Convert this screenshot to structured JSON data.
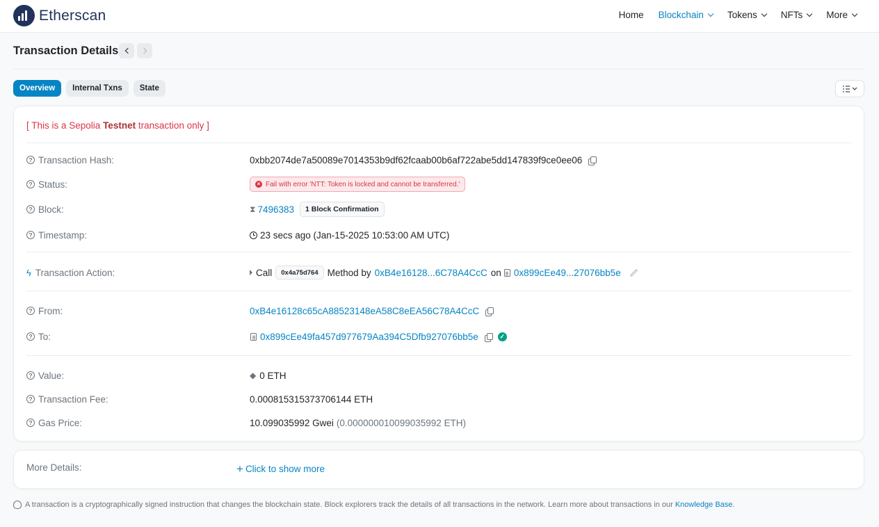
{
  "brand": {
    "name": "Etherscan"
  },
  "nav": [
    {
      "label": "Home",
      "has_dropdown": false,
      "active": false
    },
    {
      "label": "Blockchain",
      "has_dropdown": true,
      "active": true
    },
    {
      "label": "Tokens",
      "has_dropdown": true,
      "active": false
    },
    {
      "label": "NFTs",
      "has_dropdown": true,
      "active": false
    },
    {
      "label": "More",
      "has_dropdown": true,
      "active": false
    }
  ],
  "page": {
    "title": "Transaction Details"
  },
  "tabs": [
    {
      "label": "Overview",
      "active": true
    },
    {
      "label": "Internal Txns",
      "active": false
    },
    {
      "label": "State",
      "active": false
    }
  ],
  "notice": {
    "prefix": "[ This is a Sepolia ",
    "strong": "Testnet",
    "suffix": " transaction only ]"
  },
  "details": {
    "hash": {
      "label": "Transaction Hash:",
      "value": "0xbb2074de7a50089e7014353b9df62fcaab00b6af722abe5dd147839f9ce0ee06"
    },
    "status": {
      "label": "Status:",
      "value": "Fail with error 'NTT: Token is locked and cannot be transferred.'"
    },
    "block": {
      "label": "Block:",
      "number": "7496383",
      "confirmations": "1 Block Confirmation"
    },
    "timestamp": {
      "label": "Timestamp:",
      "value": "23 secs ago (Jan-15-2025 10:53:00 AM UTC)"
    },
    "action": {
      "label": "Transaction Action:",
      "call": "Call",
      "method_id": "0x4a75d764",
      "method_by": "Method by",
      "from_short": "0xB4e16128...6C78A4CcC",
      "on": "on",
      "to_short": "0x899cEe49...27076bb5e"
    },
    "from": {
      "label": "From:",
      "value": "0xB4e16128c65cA88523148eA58C8eEA56C78A4CcC"
    },
    "to": {
      "label": "To:",
      "value": "0x899cEe49fa457d977679Aa394C5Dfb927076bb5e"
    },
    "value": {
      "label": "Value:",
      "value": "0 ETH"
    },
    "fee": {
      "label": "Transaction Fee:",
      "value": "0.000815315373706144 ETH"
    },
    "gas": {
      "label": "Gas Price:",
      "value": "10.099035992 Gwei",
      "eth": "(0.000000010099035992 ETH)"
    }
  },
  "more_details": {
    "label": "More Details:",
    "link": "Click to show more"
  },
  "footer": {
    "text": "A transaction is a cryptographically signed instruction that changes the blockchain state. Block explorers track the details of all transactions in the network. Learn more about transactions in our ",
    "link": "Knowledge Base",
    "end": "."
  },
  "colors": {
    "accent": "#0784c3",
    "danger": "#dc3545",
    "success": "#00a186",
    "navy": "#21325b"
  },
  "icons": [
    "help-circle-icon",
    "copy-icon",
    "x-circle-icon",
    "hourglass-icon",
    "clock-icon",
    "bolt-icon",
    "document-icon",
    "pencil-icon",
    "check-circle-icon",
    "eth-icon",
    "plus-icon",
    "lightbulb-icon",
    "filter-list-icon"
  ]
}
